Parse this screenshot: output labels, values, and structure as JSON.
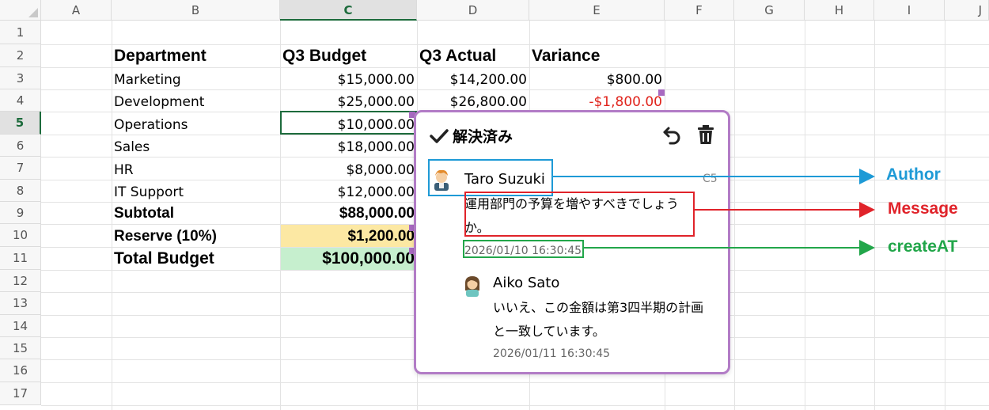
{
  "columns": [
    "A",
    "B",
    "C",
    "D",
    "E",
    "F",
    "G",
    "H",
    "I",
    "J"
  ],
  "rows": [
    "1",
    "2",
    "3",
    "4",
    "5",
    "6",
    "7",
    "8",
    "9",
    "10",
    "11",
    "12",
    "13",
    "14",
    "15",
    "16",
    "17"
  ],
  "selection": {
    "column": "C",
    "row": "5"
  },
  "table": {
    "headers": [
      "Department",
      "Q3 Budget",
      "Q3 Actual",
      "Variance"
    ],
    "rows": [
      [
        "Marketing",
        "$15,000.00",
        "$14,200.00",
        "$800.00"
      ],
      [
        "Development",
        "$25,000.00",
        "$26,800.00",
        "-$1,800.00"
      ],
      [
        "Operations",
        "$10,000.00",
        "",
        ""
      ],
      [
        "Sales",
        "$18,000.00",
        "",
        ""
      ],
      [
        "HR",
        "$8,000.00",
        "",
        ""
      ],
      [
        "IT Support",
        "$12,000.00",
        "",
        ""
      ]
    ],
    "subtotal": {
      "label": "Subtotal",
      "value": "$88,000.00"
    },
    "reserve": {
      "label": "Reserve (10%)",
      "value": "$1,200.00"
    },
    "total": {
      "label": "Total Budget",
      "value": "$100,000.00"
    }
  },
  "colors": {
    "selection": "#1d6b3c",
    "negative": "#e0231b",
    "reserve_fill": "#fce8a3",
    "total_fill": "#c6efce",
    "popup_border": "#b27cc6",
    "author_box": "#1e9ad6",
    "message_box": "#e0232a",
    "time_box": "#22a64a"
  },
  "comment_thread": {
    "status": "解決済み",
    "status_icon": "check-icon",
    "reopen_icon": "undo-icon",
    "delete_icon": "trash-icon",
    "cell_ref": "C5",
    "comments": [
      {
        "author": "Taro Suzuki",
        "avatar": "man-avatar-icon",
        "message": "運用部門の予算を増やすべきでしょうか。",
        "time": "2026/01/10 16:30:45"
      },
      {
        "author": "Aiko Sato",
        "avatar": "woman-avatar-icon",
        "message": "いいえ、この金額は第3四半期の計画と一致しています。",
        "time": "2026/01/11 16:30:45"
      }
    ]
  },
  "annotations": {
    "author": "Author",
    "message": "Message",
    "created": "createAT"
  }
}
